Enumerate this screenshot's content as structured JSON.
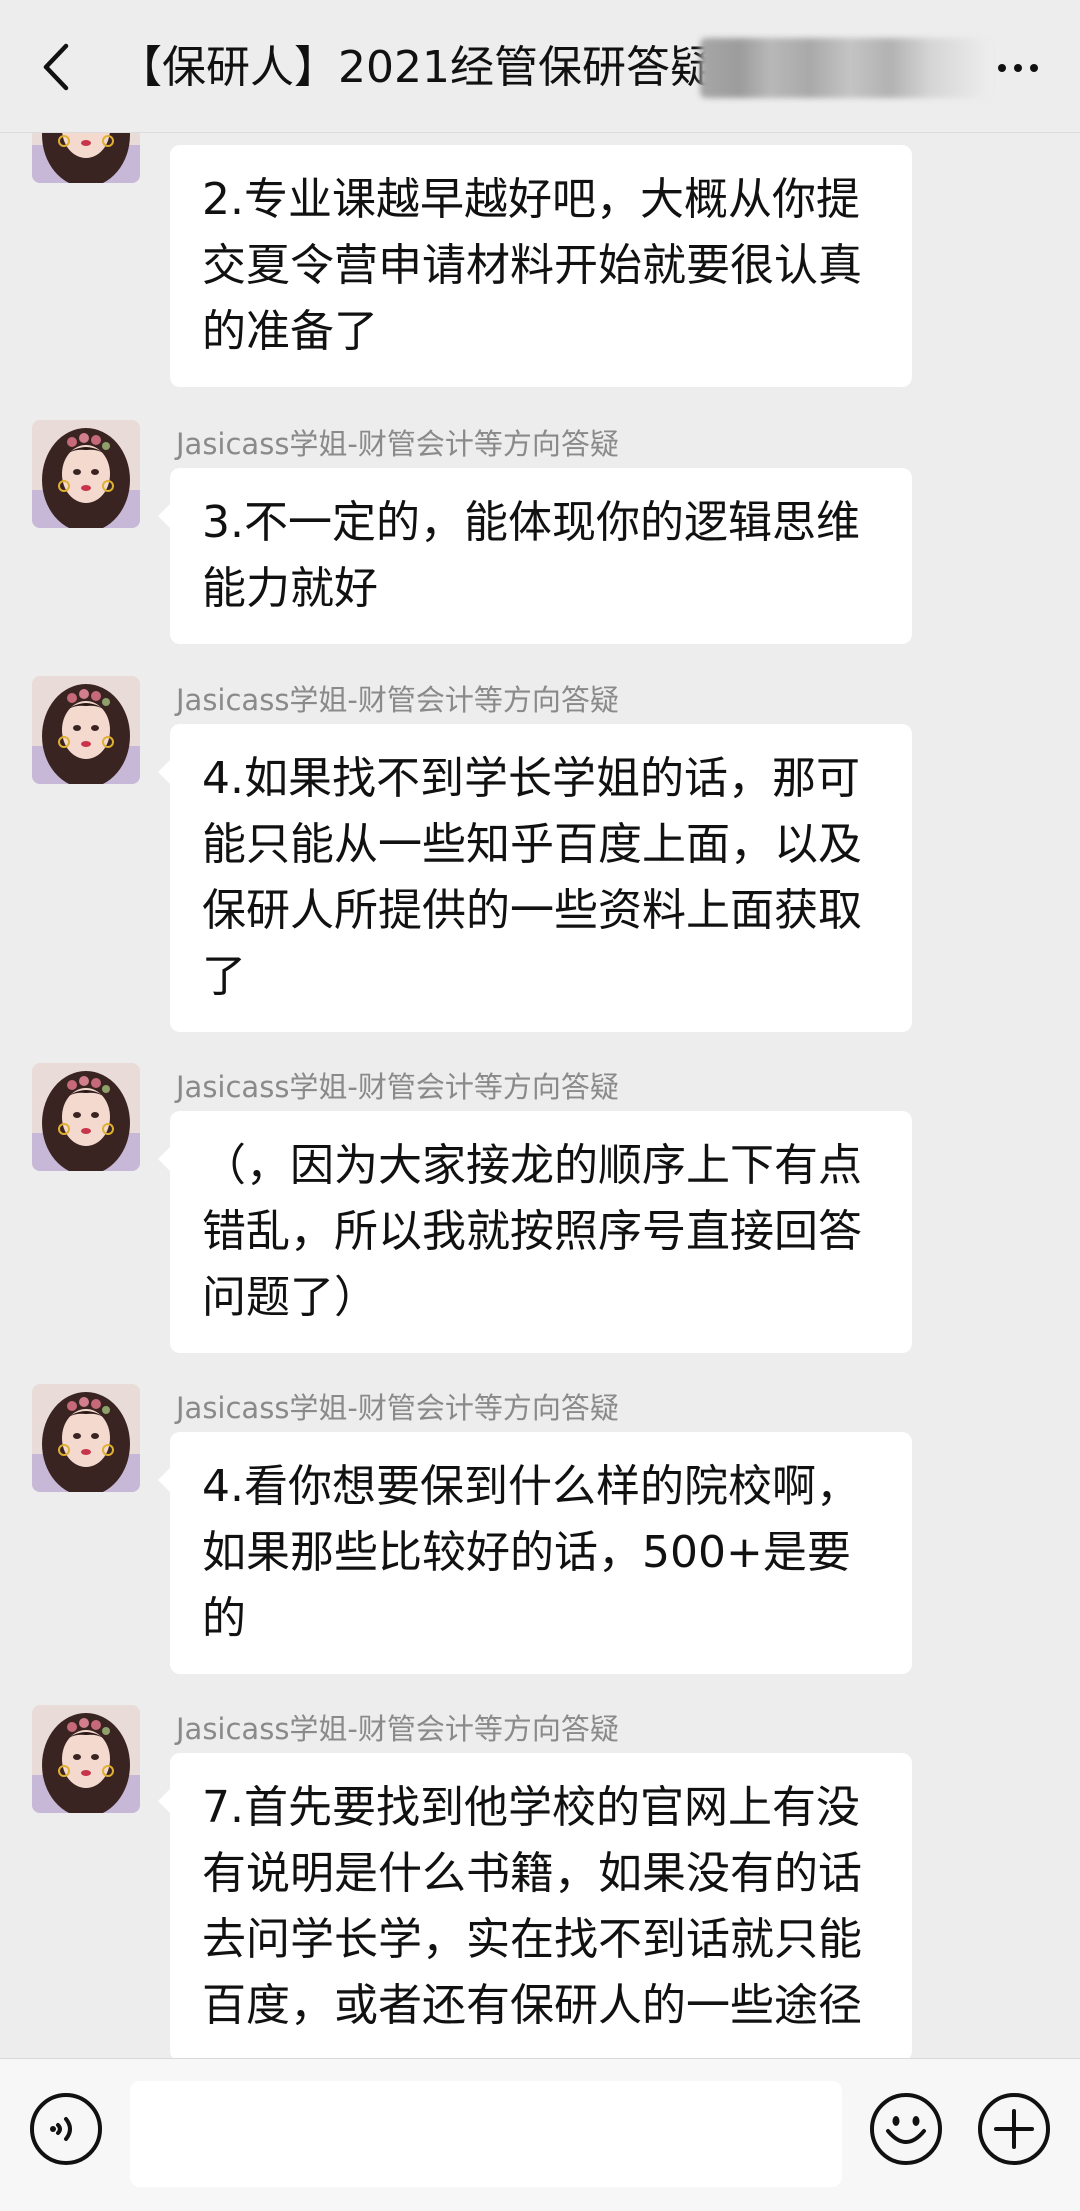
{
  "header": {
    "title": "【保研人】2021经管保研答疑"
  },
  "messages": [
    {
      "sender": "Jasicass学姐-财管会计等方向答疑",
      "text": "2.专业课越早越好吧，大概从你提交夏令营申请材料开始就要很认真的准备了"
    },
    {
      "sender": "Jasicass学姐-财管会计等方向答疑",
      "text": "3.不一定的，能体现你的逻辑思维能力就好"
    },
    {
      "sender": "Jasicass学姐-财管会计等方向答疑",
      "text": "4.如果找不到学长学姐的话，那可能只能从一些知乎百度上面，以及保研人所提供的一些资料上面获取了"
    },
    {
      "sender": "Jasicass学姐-财管会计等方向答疑",
      "text": "（，因为大家接龙的顺序上下有点错乱，所以我就按照序号直接回答问题了）"
    },
    {
      "sender": "Jasicass学姐-财管会计等方向答疑",
      "text": "4.看你想要保到什么样的院校啊，如果那些比较好的话，500+是要的"
    },
    {
      "sender": "Jasicass学姐-财管会计等方向答疑",
      "text": "7.首先要找到他学校的官网上有没有说明是什么书籍，如果没有的话去问学长学，实在找不到话就只能百度，或者还有保研人的一些途径"
    }
  ],
  "input": {
    "value": "",
    "placeholder": ""
  },
  "colors": {
    "background": "#ededed",
    "bubble": "#ffffff",
    "sender": "#8a8a8a"
  },
  "icons": [
    "back-arrow-icon",
    "more-icon",
    "voice-icon",
    "emoji-icon",
    "plus-icon",
    "avatar-image"
  ]
}
